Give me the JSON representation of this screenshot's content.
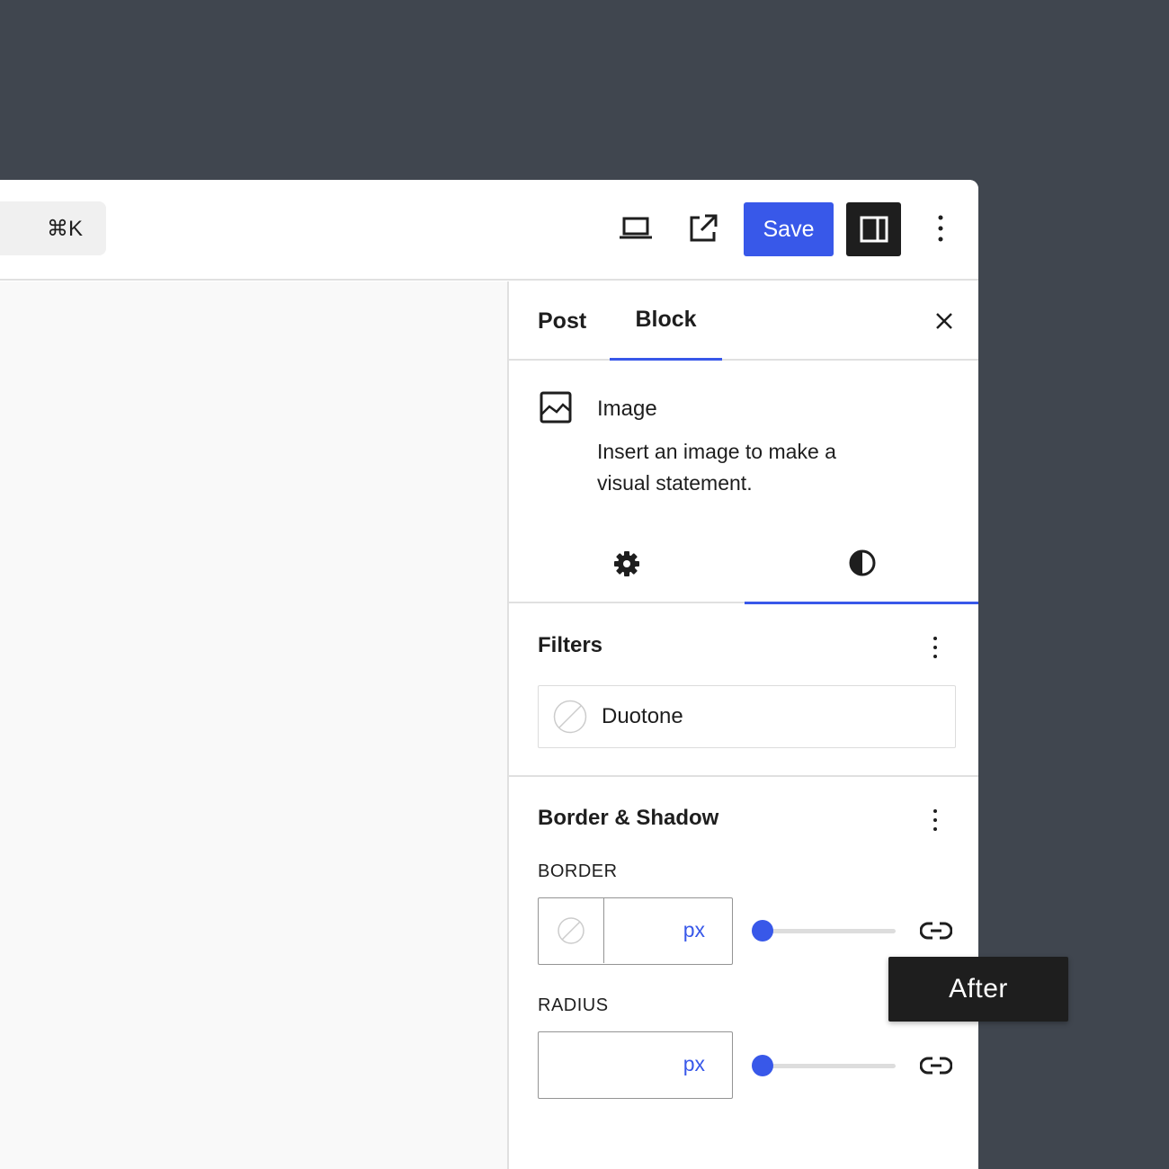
{
  "toolbar": {
    "command_shortcut": "⌘K",
    "save_label": "Save"
  },
  "sidebar": {
    "tabs": [
      {
        "label": "Post",
        "active": false
      },
      {
        "label": "Block",
        "active": true
      }
    ],
    "block": {
      "title": "Image",
      "description": "Insert an image to make a visual statement."
    },
    "filters": {
      "title": "Filters",
      "duotone_label": "Duotone"
    },
    "border_shadow": {
      "title": "Border & Shadow",
      "border_label": "BORDER",
      "border_unit": "px",
      "radius_label": "RADIUS",
      "radius_unit": "px"
    }
  },
  "tooltip": {
    "text": "After"
  },
  "colors": {
    "accent": "#3858e9",
    "background": "#40464f",
    "dark": "#1e1e1e"
  },
  "icons": [
    "laptop-icon",
    "external-link-icon",
    "sidebar-panel-icon",
    "more-vertical-icon",
    "close-icon",
    "image-icon",
    "gear-icon",
    "contrast-icon",
    "no-color-icon",
    "link-icon"
  ]
}
